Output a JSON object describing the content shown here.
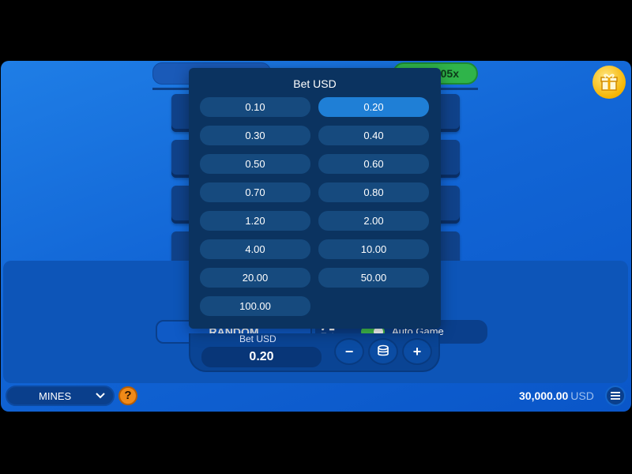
{
  "top": {
    "multiplier": "05x"
  },
  "controls": {
    "random_label": "RANDOM",
    "auto_game_label": "Auto Game",
    "auto_game_enabled": true,
    "bet_label": "Bet USD",
    "bet_value": "0.20",
    "minus_label": "−",
    "plus_label": "+"
  },
  "footer": {
    "game_select": "MINES",
    "help_label": "?",
    "balance": "30,000.00",
    "currency": "USD"
  },
  "bet_popup": {
    "title": "Bet USD",
    "selected": "0.20",
    "options": [
      "0.10",
      "0.20",
      "0.30",
      "0.40",
      "0.50",
      "0.60",
      "0.70",
      "0.80",
      "1.20",
      "2.00",
      "4.00",
      "10.00",
      "20.00",
      "50.00",
      "100.00"
    ]
  },
  "colors": {
    "accent_green": "#2fb44a",
    "popup_bg": "#0b3360",
    "option_selected": "#1f7fd6",
    "gift_gold": "#f5b400",
    "help_orange": "#f08a18"
  },
  "icons": [
    "gift-icon",
    "swap-icon",
    "coin-stack-icon",
    "chevron-down-icon",
    "menu-icon"
  ]
}
